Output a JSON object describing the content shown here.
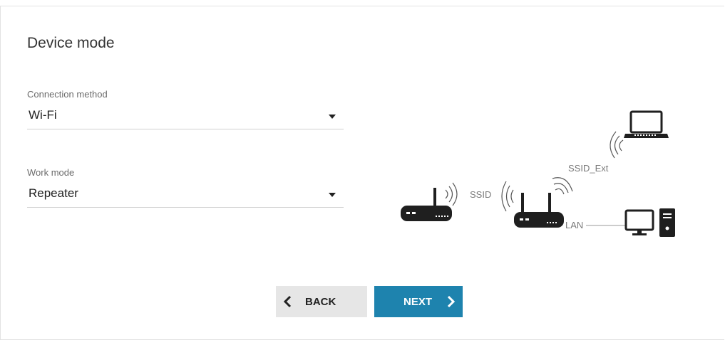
{
  "page": {
    "title": "Device mode"
  },
  "connection_method": {
    "label": "Connection method",
    "value": "Wi-Fi"
  },
  "work_mode": {
    "label": "Work mode",
    "value": "Repeater"
  },
  "diagram": {
    "ssid_label": "SSID",
    "ssid_ext_label": "SSID_Ext",
    "lan_label": "LAN",
    "icons": [
      "router-icon",
      "repeater-router-icon",
      "laptop-icon",
      "desktop-computer-icon",
      "wifi-signal-icon"
    ]
  },
  "buttons": {
    "back_label": "BACK",
    "next_label": "NEXT"
  },
  "colors": {
    "accent": "#1e83ae",
    "device": "#1f1f1f",
    "muted_text": "#7a7a7a"
  }
}
